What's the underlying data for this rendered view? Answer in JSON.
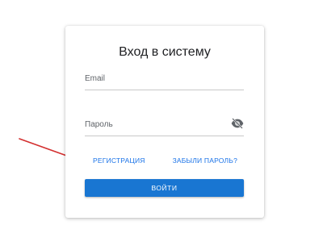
{
  "login_form": {
    "title": "Вход в систему",
    "email_placeholder": "Email",
    "password_placeholder": "Пароль",
    "password_toggle_icon": "eye-off-icon",
    "register_link": "РЕГИСТРАЦИЯ",
    "forgot_password_link": "ЗАБЫЛИ ПАРОЛЬ?",
    "login_button": "ВОЙТИ"
  },
  "colors": {
    "accent": "#1976d2",
    "link": "#1a73e8",
    "annotation_arrow": "#d32f2f"
  }
}
